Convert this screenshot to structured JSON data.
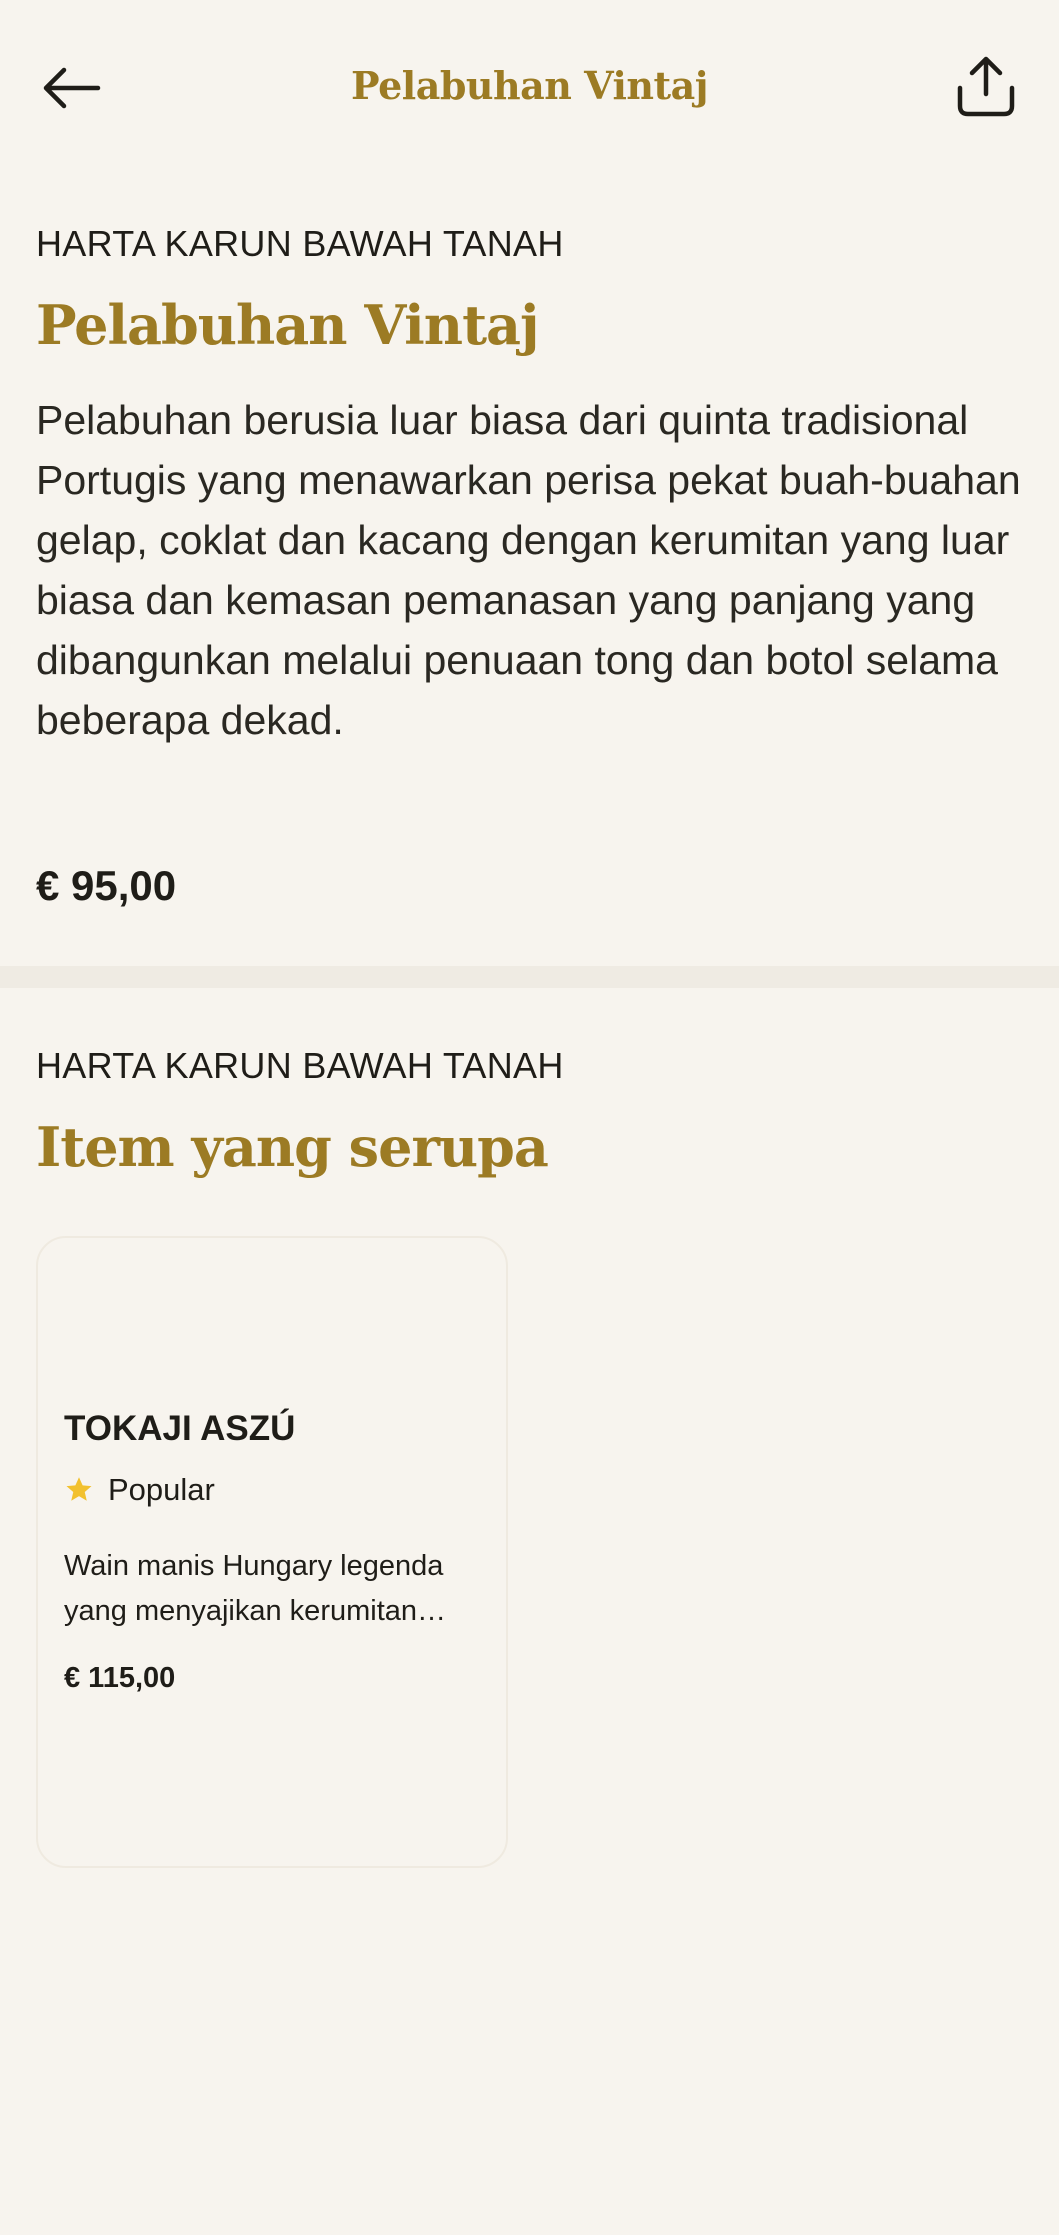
{
  "header": {
    "title": "Pelabuhan Vintaj",
    "back_icon": "arrow-left-icon",
    "share_icon": "share-icon"
  },
  "product": {
    "category": "HARTA KARUN BAWAH TANAH",
    "name": "Pelabuhan Vintaj",
    "description": "Pelabuhan berusia luar biasa dari quinta tradisional Portugis yang menawarkan perisa pekat buah-buahan gelap, coklat dan kacang dengan kerumitan yang luar biasa dan kemasan pemanasan yang panjang yang dibangunkan melalui penuaan tong dan botol selama beberapa dekad.",
    "price": "€ 95,00"
  },
  "similar": {
    "category": "HARTA KARUN BAWAH TANAH",
    "heading": "Item yang serupa",
    "items": [
      {
        "name": "TOKAJI ASZÚ",
        "badge": "Popular",
        "badge_icon": "star-icon",
        "description": "Wain manis Hungary legenda yang menyajikan kerumitan…",
        "price": "€ 115,00"
      }
    ]
  },
  "colors": {
    "background": "#f7f4ee",
    "accent_gold": "#9c7b24",
    "text": "#1f1d18",
    "star": "#f2c12e"
  }
}
